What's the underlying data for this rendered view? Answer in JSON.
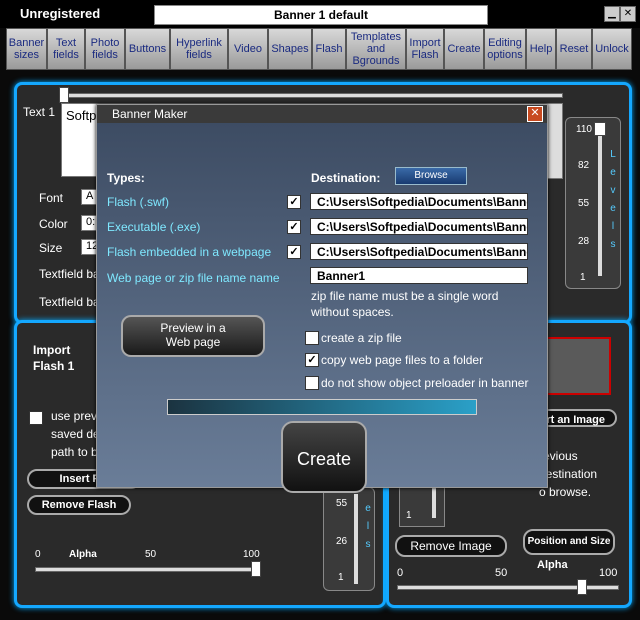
{
  "window": {
    "status": "Unregistered",
    "banner_name": "Banner 1 default",
    "minimize": "▁",
    "close": "✕"
  },
  "toolbar": [
    {
      "label": "Banner sizes"
    },
    {
      "label": "Text fields"
    },
    {
      "label": "Photo fields"
    },
    {
      "label": "Buttons"
    },
    {
      "label": "Hyperlink fields"
    },
    {
      "label": "Video"
    },
    {
      "label": "Shapes"
    },
    {
      "label": "Flash"
    },
    {
      "label": "Templates and Bgrounds"
    },
    {
      "label": "Import Flash"
    },
    {
      "label": "Create"
    },
    {
      "label": "Editing options"
    },
    {
      "label": "Help"
    },
    {
      "label": "Reset"
    },
    {
      "label": "Unlock"
    }
  ],
  "text_panel": {
    "text_label": "Text 1",
    "text_value": "Softp",
    "font_label": "Font",
    "font_value": "A",
    "color_label": "Color",
    "color_value": "0:",
    "size_label": "Size",
    "size_value": "12",
    "textfield_bg1": "Textfield ba",
    "textfield_bg2": "Textfield ba"
  },
  "levels_panel": {
    "ticks": [
      "110",
      "82",
      "55",
      "28",
      "1"
    ],
    "label_letters": [
      "L",
      "e",
      "v",
      "e",
      "l",
      "s"
    ]
  },
  "flash_panel": {
    "title_line1": "Import",
    "title_line2": "Flash 1",
    "use_prev_1": "use prev",
    "use_prev_2": "saved de",
    "use_prev_3": "path to b",
    "insert_btn": "Insert Fla",
    "remove_btn": "Remove Flash",
    "alpha_label": "Alpha",
    "alpha_0": "0",
    "alpha_50": "50",
    "alpha_100": "100",
    "mini_ticks": [
      "55",
      "26",
      "1"
    ],
    "mini_letters": [
      "e",
      "l",
      "s"
    ]
  },
  "image_panel": {
    "insert_btn": "rt an Image",
    "prev_1": "revious",
    "prev_2": "destination",
    "prev_3": "o browse.",
    "tick_1": "1",
    "remove_btn": "Remove Image",
    "pos_btn": "Position and Size",
    "alpha_label": "Alpha",
    "alpha_0": "0",
    "alpha_50": "50",
    "alpha_100": "100"
  },
  "dialog": {
    "title": "Banner Maker",
    "close": "✕",
    "types_label": "Types:",
    "destination_label": "Destination:",
    "browse": "Browse",
    "types": [
      {
        "label": "Flash (.swf)",
        "checked": "✓",
        "path": "C:\\Users\\Softpedia\\Documents\\Banne"
      },
      {
        "label": "Executable (.exe)",
        "checked": "✓",
        "path": "C:\\Users\\Softpedia\\Documents\\Banne"
      },
      {
        "label": "Flash embedded in a webpage",
        "checked": "✓",
        "path": "C:\\Users\\Softpedia\\Documents\\Banne"
      }
    ],
    "name_label": "Web page or zip file name name",
    "name_value": "Banner1",
    "zip_note_1": "zip file name must be a single word",
    "zip_note_2": "without spaces.",
    "preview_1": "Preview in a",
    "preview_2": "Web page",
    "opt_zip": "create a zip file",
    "opt_zip_checked": "",
    "opt_copy": "copy web page files to a folder",
    "opt_copy_checked": "✓",
    "opt_preloader": "do not show object preloader in banner",
    "opt_preloader_checked": "",
    "progress": 1.0,
    "create": "Create"
  }
}
